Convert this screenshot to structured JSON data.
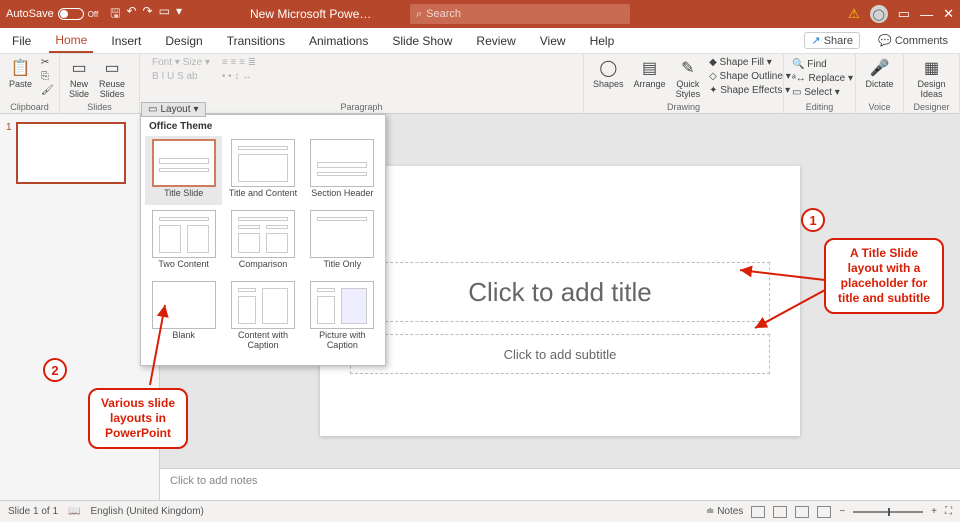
{
  "titlebar": {
    "autosave": "AutoSave",
    "autosave_state": "Off",
    "doc": "New Microsoft Powe…",
    "search": "Search"
  },
  "menu": {
    "file": "File",
    "home": "Home",
    "insert": "Insert",
    "design": "Design",
    "transitions": "Transitions",
    "animations": "Animations",
    "slideshow": "Slide Show",
    "review": "Review",
    "view": "View",
    "help": "Help",
    "share": "Share",
    "comments": "Comments"
  },
  "ribbon": {
    "paste": "Paste",
    "clipboard": "Clipboard",
    "newslide": "New\nSlide",
    "reuse": "Reuse\nSlides",
    "layout": "Layout",
    "slides": "Slides",
    "paragraph": "Paragraph",
    "shapes": "Shapes",
    "arrange": "Arrange",
    "quick": "Quick\nStyles",
    "drawing": "Drawing",
    "find": "Find",
    "replace": "Replace",
    "select": "Select",
    "editing": "Editing",
    "dictate": "Dictate",
    "voice": "Voice",
    "design_ideas": "Design\nIdeas",
    "designer": "Designer",
    "shape_fill": "Shape Fill",
    "shape_outline": "Shape Outline",
    "shape_effects": "Shape Effects"
  },
  "layout_menu": {
    "button": "Layout",
    "theme": "Office Theme",
    "items": [
      "Title Slide",
      "Title and Content",
      "Section Header",
      "Two Content",
      "Comparison",
      "Title Only",
      "Blank",
      "Content with\nCaption",
      "Picture with\nCaption"
    ]
  },
  "slide": {
    "title_ph": "Click to add title",
    "sub_ph": "Click to add subtitle"
  },
  "notes": "Click to add notes",
  "status": {
    "slide": "Slide 1 of 1",
    "lang": "English (United Kingdom)",
    "notes": "Notes"
  },
  "callouts": {
    "c1": "A Title Slide\nlayout with a\nplaceholder for\ntitle and subtitle",
    "c1num": "1",
    "c2": "Various slide\nlayouts in\nPowerPoint",
    "c2num": "2"
  },
  "thumb": {
    "num": "1"
  }
}
